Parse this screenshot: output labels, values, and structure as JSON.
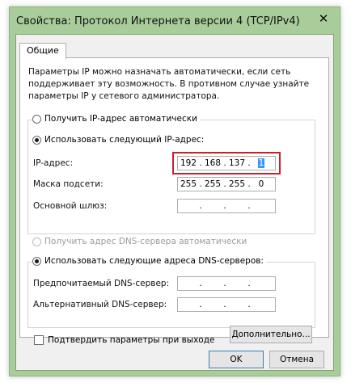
{
  "window": {
    "title": "Свойства: Протокол Интернета версии 4 (TCP/IPv4)",
    "close_glyph": "✕"
  },
  "tabs": [
    {
      "label": "Общие",
      "active": true
    }
  ],
  "general": {
    "intro": "Параметры IP можно назначать автоматически, если сеть поддерживает эту возможность. В противном случае узнайте параметры IP у сетевого администратора.",
    "ip_mode": {
      "auto_label": "Получить IP-адрес автоматически",
      "manual_label": "Использовать следующий IP-адрес:",
      "selected": "manual"
    },
    "ip_address": {
      "label": "IP-адрес:",
      "octets": [
        "192",
        "168",
        "137",
        "1"
      ],
      "selected_octet": 4
    },
    "subnet_mask": {
      "label": "Маска подсети:",
      "octets": [
        "255",
        "255",
        "255",
        "0"
      ]
    },
    "gateway": {
      "label": "Основной шлюз:",
      "octets": [
        "",
        "",
        "",
        ""
      ]
    },
    "dns_mode": {
      "auto_label": "Получить адрес DNS-сервера автоматически",
      "auto_disabled": true,
      "manual_label": "Использовать следующие адреса DNS-серверов:",
      "selected": "manual"
    },
    "preferred_dns": {
      "label": "Предпочитаемый DNS-сервер:",
      "octets": [
        "",
        "",
        "",
        ""
      ]
    },
    "alternate_dns": {
      "label": "Альтернативный DNS-сервер:",
      "octets": [
        "",
        "",
        "",
        ""
      ]
    },
    "validate_on_exit": {
      "label": "Подтвердить параметры при выходе",
      "checked": false
    },
    "advanced_button": "Дополнительно..."
  },
  "footer": {
    "ok_label": "OK",
    "cancel_label": "Отмена"
  },
  "colors": {
    "title_bar": "#a9cd9a",
    "highlight_frame": "#cc1f2e",
    "selection": "#3399ff"
  }
}
